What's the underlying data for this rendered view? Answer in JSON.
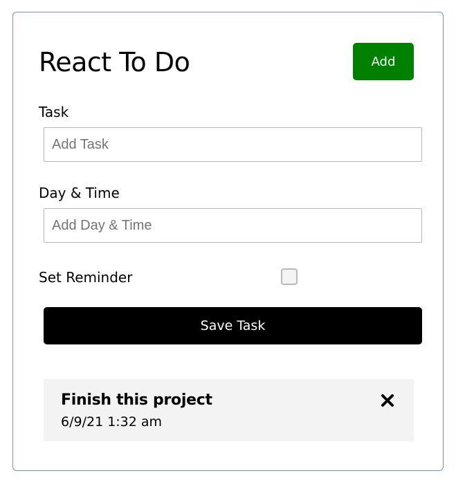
{
  "header": {
    "title": "React To Do",
    "add_label": "Add",
    "add_color": "#008000"
  },
  "form": {
    "task_label": "Task",
    "task_placeholder": "Add Task",
    "task_value": "",
    "day_label": "Day & Time",
    "day_placeholder": "Add Day & Time",
    "day_value": "",
    "reminder_label": "Set Reminder",
    "reminder_checked": false,
    "save_label": "Save Task"
  },
  "tasks": [
    {
      "text": "Finish this project",
      "day": "6/9/21 1:32 am",
      "delete_icon": "close-icon"
    }
  ]
}
